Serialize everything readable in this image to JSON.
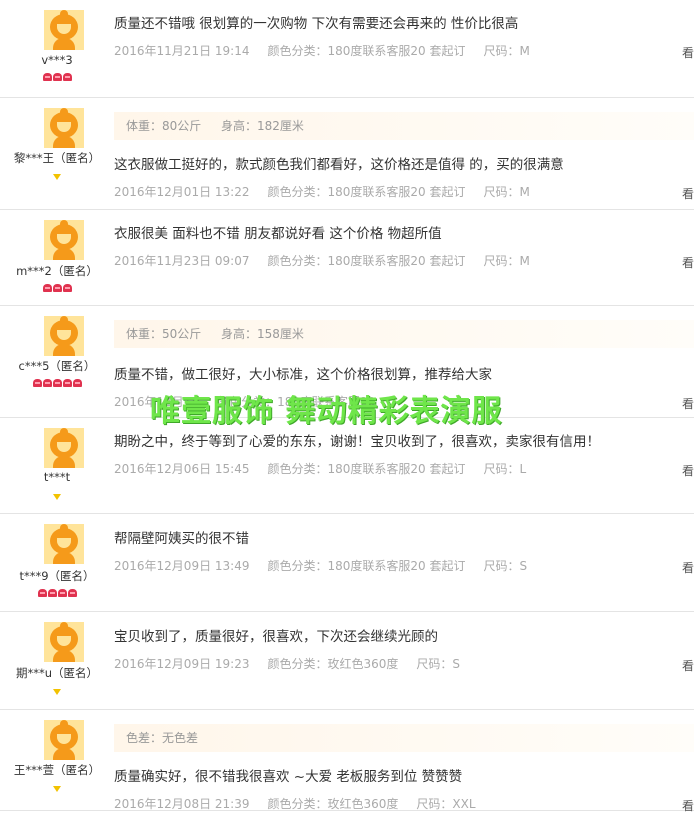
{
  "reviews": [
    {
      "user": "v***3",
      "badge": "heart",
      "badge_count": 3,
      "spec": null,
      "comment": "质量还不错哦 很划算的一次购物 下次有需要还会再来的 性价比很高",
      "date": "2016年11月21日 19:14",
      "color_label": "颜色分类：180度联系客服20 套起订",
      "size_label": "尺码：M",
      "edge": "看"
    },
    {
      "user": "黎***王（匿名）",
      "badge": "diamond",
      "badge_count": 1,
      "spec": {
        "weight": "体重：80公斤",
        "height": "身高：182厘米"
      },
      "comment": "这衣服做工挺好的，款式颜色我们都看好，这价格还是值得 的，买的很满意",
      "date": "2016年12月01日 13:22",
      "color_label": "颜色分类：180度联系客服20 套起订",
      "size_label": "尺码：M",
      "edge": "看"
    },
    {
      "user": "m***2（匿名）",
      "badge": "heart",
      "badge_count": 3,
      "spec": null,
      "comment": "衣服很美 面料也不错 朋友都说好看 这个价格 物超所值",
      "date": "2016年11月23日 09:07",
      "color_label": "颜色分类：180度联系客服20 套起订",
      "size_label": "尺码：M",
      "edge": "看"
    },
    {
      "user": "c***5（匿名）",
      "badge": "heart",
      "badge_count": 5,
      "spec": {
        "weight": "体重：50公斤",
        "height": "身高：158厘米"
      },
      "comment": "质量不错，做工很好，大小标准，这个价格很划算，推荐给大家",
      "date": "2016年12月15",
      "color_label": "颜色分类：180度联系客服20",
      "size_label": "",
      "edge": "看"
    },
    {
      "user": "t***t",
      "badge": "diamond",
      "badge_count": 1,
      "spec": null,
      "comment": "期盼之中，终于等到了心爱的东东，谢谢！宝贝收到了，很喜欢，卖家很有信用！",
      "date": "2016年12月06日 15:45",
      "color_label": "颜色分类：180度联系客服20 套起订",
      "size_label": "尺码：L",
      "edge": "看"
    },
    {
      "user": "t***9（匿名）",
      "badge": "heart",
      "badge_count": 4,
      "spec": null,
      "comment": "帮隔壁阿姨买的很不错",
      "date": "2016年12月09日 13:49",
      "color_label": "颜色分类：180度联系客服20 套起订",
      "size_label": "尺码：S",
      "edge": "看"
    },
    {
      "user": "期***u（匿名）",
      "badge": "diamond",
      "badge_count": 1,
      "spec": null,
      "comment": "宝贝收到了，质量很好，很喜欢，下次还会继续光顾的",
      "date": "2016年12月09日 19:23",
      "color_label": "颜色分类：玫红色360度",
      "size_label": "尺码：S",
      "edge": "看"
    },
    {
      "user": "王***萱（匿名）",
      "badge": "diamond",
      "badge_count": 1,
      "spec": {
        "weight": "色差：无色差",
        "height": ""
      },
      "comment": "质量确实好，很不错我很喜欢 ~大爱 老板服务到位 赞赞赞",
      "date": "2016年12月08日 21:39",
      "color_label": "颜色分类：玫红色360度",
      "size_label": "尺码：XXL",
      "edge": "看"
    }
  ],
  "watermark": "唯壹服饰 舞动精彩表演服"
}
